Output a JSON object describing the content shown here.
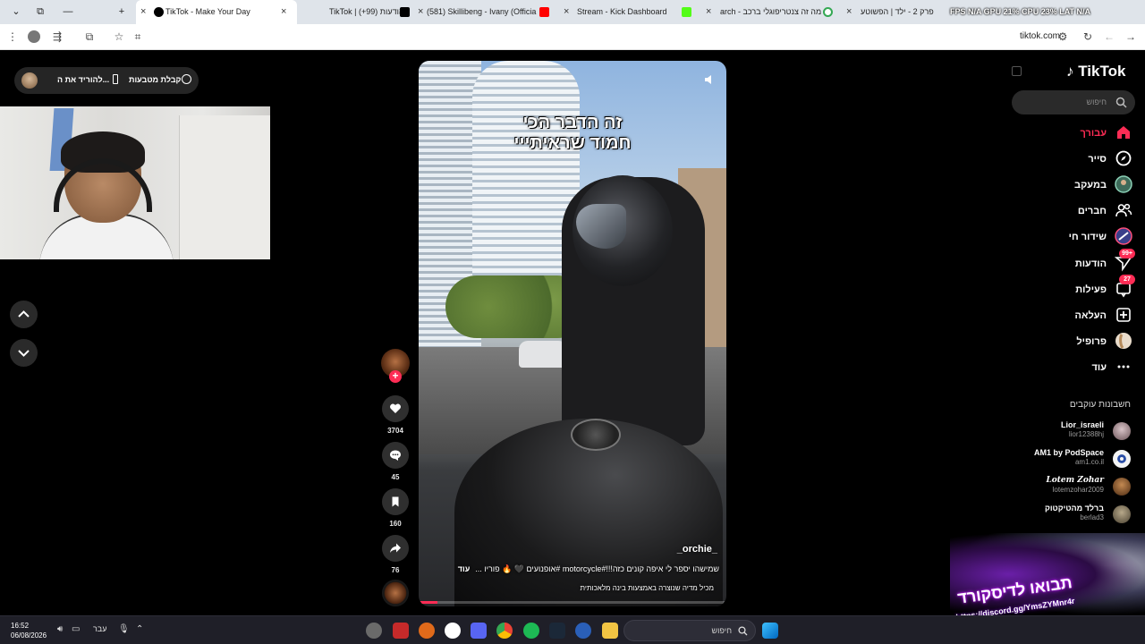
{
  "browser": {
    "tabs": [
      {
        "label": "TikTok - Make Your Day",
        "active": true
      },
      {
        "label": "TikTok | הודעות (99+)"
      },
      {
        "label": "(581) Skillibeng - Ivany (Officia"
      },
      {
        "label": "Stream - Kick Dashboard"
      },
      {
        "label": "arch - מה זה צנטריפוגלי ברכב"
      },
      {
        "label": "פרק 2 - ילד | הפשוטע"
      }
    ],
    "url": "tiktok.com",
    "overlay_stats": "FPS N/A  GPU 21%  CPU 23%  LAT N/A"
  },
  "download_pill": {
    "label_app": "קבלת מטבעות",
    "label_download": "להוריד את ה..."
  },
  "video": {
    "title_line1": "זה הדבר הכי",
    "title_line2": "חמוד שראיתייי",
    "username": "_orchie_",
    "caption": "שמישהו יספר לי איפה קונים כזה!!!#motorcycle #אופנועים 🖤 🔥 פוריו ...",
    "caption_more": "עוד",
    "ai_label": "מכיל מדיה שנוצרה באמצעות בינה מלאכותית",
    "progress": 0.06
  },
  "actions": {
    "likes": "3704",
    "comments": "45",
    "saves": "160",
    "shares": "76",
    "follow_symbol": "+"
  },
  "sidebar": {
    "logo": "TikTok",
    "search_placeholder": "חיפוש",
    "nav": [
      {
        "label": "עבורך",
        "icon": "home-icon",
        "active": true
      },
      {
        "label": "סייר",
        "icon": "compass-icon"
      },
      {
        "label": "במעקב",
        "icon": "following-avatar-icon"
      },
      {
        "label": "חברים",
        "icon": "friends-icon"
      },
      {
        "label": "שידור חי",
        "icon": "live-icon"
      },
      {
        "label": "הודעות",
        "icon": "messages-icon",
        "badge": "99+"
      },
      {
        "label": "פעילות",
        "icon": "activity-icon",
        "badge": "27"
      },
      {
        "label": "העלאה",
        "icon": "upload-icon"
      },
      {
        "label": "פרופיל",
        "icon": "profile-avatar-icon"
      },
      {
        "label": "עוד",
        "icon": "more-icon"
      }
    ],
    "following_title": "חשבונות עוקבים",
    "accounts": [
      {
        "name": "Lior_israeli",
        "handle": "lior12388hj"
      },
      {
        "name": "AM1 by PodSpace",
        "handle": "am1.co.il"
      },
      {
        "name": "Lotem Zohar",
        "handle": "lotemzohar2009"
      },
      {
        "name": "ברלד מהטיקטוק",
        "handle": "berlad3"
      }
    ]
  },
  "promo": {
    "headline": "תבואו לדיסקורד",
    "url": "https://discord.gg/YmsZYMnr4r"
  },
  "taskbar": {
    "time": "16:52",
    "date": "06/08/2026",
    "lang": "עבר",
    "search_placeholder": "חיפוש"
  },
  "colors": {
    "accent": "#fe2c55",
    "background": "#000000",
    "panel": "#2a2a2a"
  }
}
